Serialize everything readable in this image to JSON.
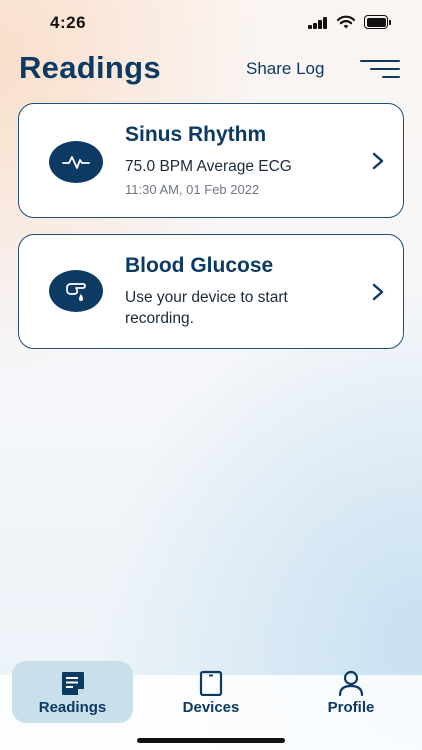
{
  "status_bar": {
    "time": "4:26",
    "icons": [
      "signal-icon",
      "wifi-icon",
      "battery-icon"
    ]
  },
  "header": {
    "title": "Readings",
    "share_log_label": "Share Log",
    "filter_icon": "filter-icon"
  },
  "cards": [
    {
      "icon": "ecg-wave-icon",
      "title": "Sinus Rhythm",
      "subtitle": "75.0 BPM Average ECG",
      "timestamp": "11:30 AM, 01 Feb 2022"
    },
    {
      "icon": "finger-drop-icon",
      "title": "Blood Glucose",
      "subtitle": "Use your device to start recording."
    }
  ],
  "tabs": [
    {
      "label": "Readings",
      "icon": "readings-icon",
      "selected": true
    },
    {
      "label": "Devices",
      "icon": "device-icon",
      "selected": false
    },
    {
      "label": "Profile",
      "icon": "profile-icon",
      "selected": false
    }
  ],
  "colors": {
    "primary": "#0d3a63",
    "card_border": "#1f4f7a",
    "selected_tab_bg": "#c9dfea",
    "timestamp": "#6f7780"
  }
}
